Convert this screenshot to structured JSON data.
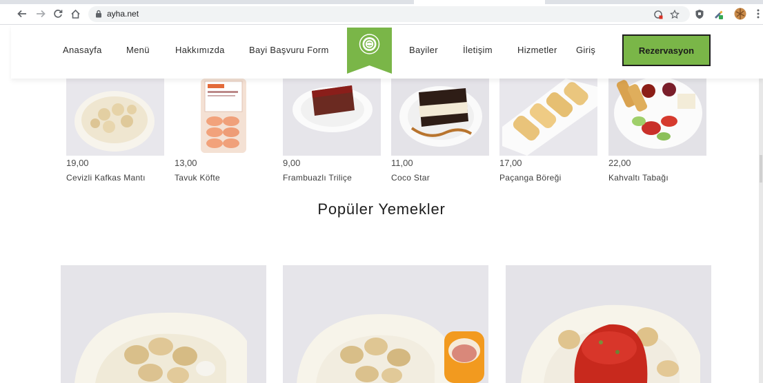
{
  "browser": {
    "url": "ayha.net"
  },
  "nav": {
    "items": [
      "Anasayfa",
      "Menü",
      "Hakkımızda",
      "Bayi Başvuru Form",
      "Bayiler",
      "İletişim",
      "Hizmetler",
      "Giriş"
    ],
    "cta": "Rezervasyon",
    "accent": "#7ab648"
  },
  "products": [
    {
      "price": "19,00",
      "name": "Cevizli Kafkas Mantı"
    },
    {
      "price": "13,00",
      "name": "Tavuk Köfte"
    },
    {
      "price": "9,00",
      "name": "Frambuazlı Triliçe"
    },
    {
      "price": "11,00",
      "name": "Coco Star"
    },
    {
      "price": "17,00",
      "name": "Paçanga Böreği"
    },
    {
      "price": "22,00",
      "name": "Kahvaltı Tabağı"
    }
  ],
  "popular": {
    "title": "Popüler Yemekler"
  }
}
